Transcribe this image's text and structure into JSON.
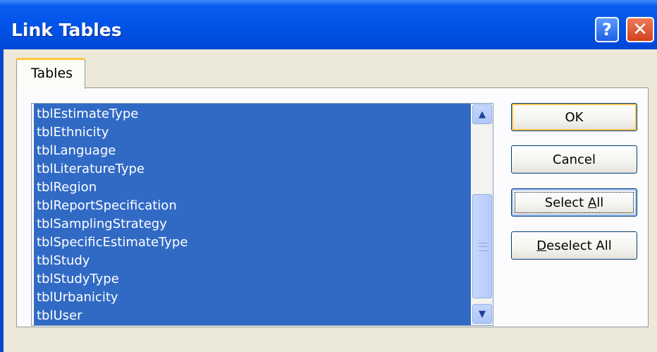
{
  "window": {
    "title": "Link Tables"
  },
  "title_buttons": {
    "help_glyph": "?",
    "close_glyph": "✕"
  },
  "tabs": [
    {
      "label": "Tables",
      "selected": true
    }
  ],
  "table_list": {
    "items": [
      "tblEstimateType",
      "tblEthnicity",
      "tblLanguage",
      "tblLiteratureType",
      "tblRegion",
      "tblReportSpecification",
      "tblSamplingStrategy",
      "tblSpecificEstimateType",
      "tblStudy",
      "tblStudyType",
      "tblUrbanicity",
      "tblUser"
    ],
    "all_selected": true,
    "selection_color": "#316ac5"
  },
  "scrollbar": {
    "up_glyph": "▲",
    "down_glyph": "▼"
  },
  "buttons": {
    "ok": "OK",
    "cancel": "Cancel",
    "select_all": {
      "before": "Select ",
      "accel": "A",
      "after": "ll"
    },
    "deselect_all": {
      "before": "",
      "accel": "D",
      "after": "eselect All"
    }
  },
  "colors": {
    "titlebar": "#0053e6",
    "dialog_bg": "#ece9d8",
    "tab_highlight": "#ffc83c",
    "close_button": "#d3421d"
  }
}
